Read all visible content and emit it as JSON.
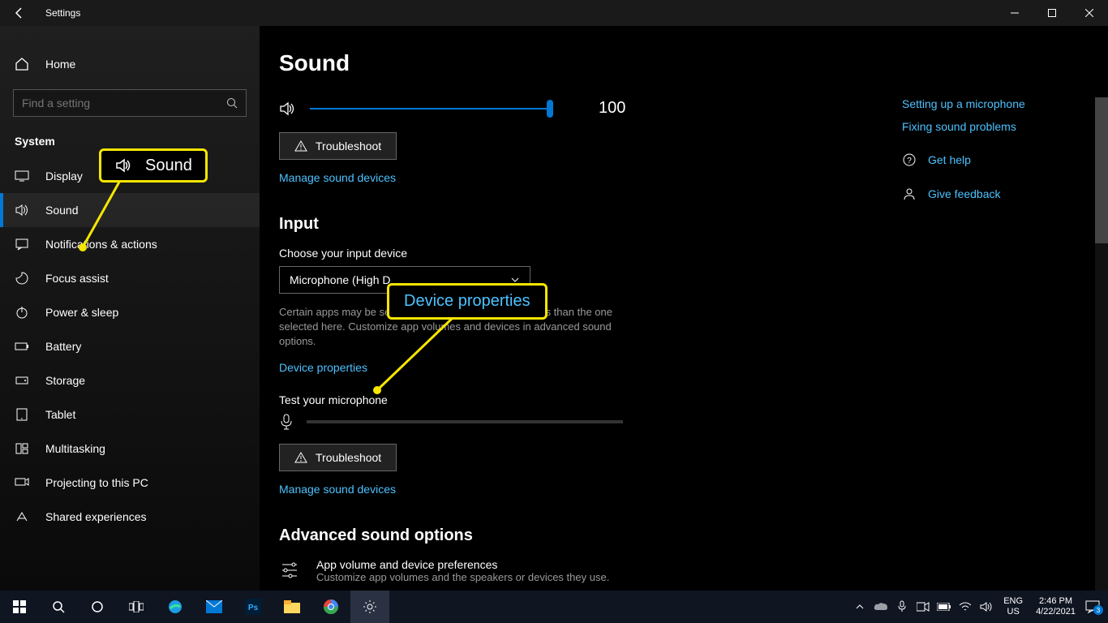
{
  "titlebar": {
    "title": "Settings"
  },
  "sidebar": {
    "home": "Home",
    "search_placeholder": "Find a setting",
    "category": "System",
    "items": [
      {
        "label": "Display"
      },
      {
        "label": "Sound"
      },
      {
        "label": "Notifications & actions"
      },
      {
        "label": "Focus assist"
      },
      {
        "label": "Power & sleep"
      },
      {
        "label": "Battery"
      },
      {
        "label": "Storage"
      },
      {
        "label": "Tablet"
      },
      {
        "label": "Multitasking"
      },
      {
        "label": "Projecting to this PC"
      },
      {
        "label": "Shared experiences"
      }
    ]
  },
  "page": {
    "title": "Sound",
    "volume_value": "100",
    "troubleshoot": "Troubleshoot",
    "manage_devices": "Manage sound devices",
    "input_heading": "Input",
    "choose_input": "Choose your input device",
    "input_device": "Microphone (High D",
    "input_desc": "Certain apps may be set up to use different sound devices than the one selected here. Customize app volumes and devices in advanced sound options.",
    "device_props": "Device properties",
    "test_mic": "Test your microphone",
    "troubleshoot2": "Troubleshoot",
    "manage_devices2": "Manage sound devices",
    "adv_heading": "Advanced sound options",
    "adv_item_title": "App volume and device preferences",
    "adv_item_desc": "Customize app volumes and the speakers or devices they use."
  },
  "right": {
    "link1": "Setting up a microphone",
    "link2": "Fixing sound problems",
    "help": "Get help",
    "feedback": "Give feedback"
  },
  "callouts": {
    "sound": "Sound",
    "devprops": "Device properties"
  },
  "taskbar": {
    "lang1": "ENG",
    "lang2": "US",
    "time": "2:46 PM",
    "date": "4/22/2021",
    "notif": "3"
  }
}
